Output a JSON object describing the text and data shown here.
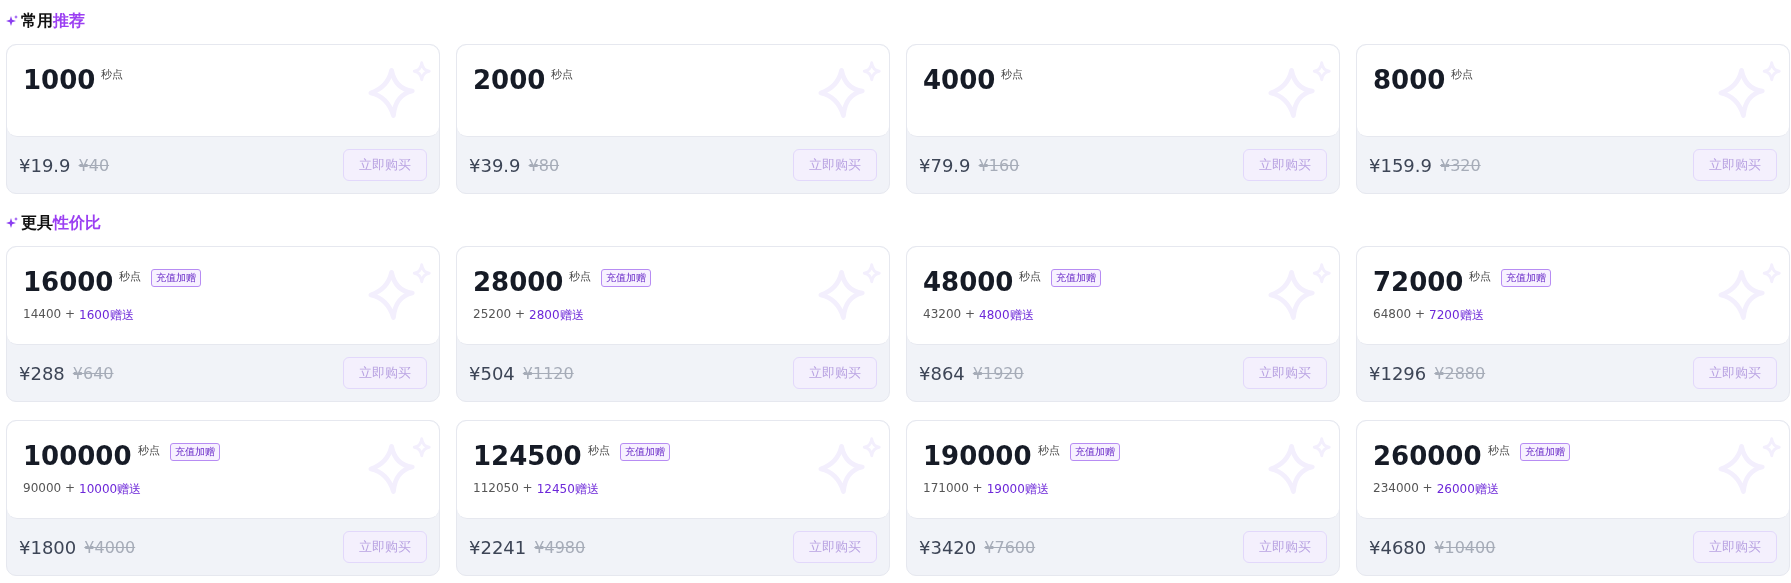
{
  "sections": [
    {
      "title": "常用",
      "title_accent": "推荐",
      "cards": [
        {
          "amount": "1000",
          "unit": "秒点",
          "price": "¥19.9",
          "original_price": "¥40",
          "button": {
            "label": "立即购买",
            "disabled": true
          }
        },
        {
          "amount": "2000",
          "unit": "秒点",
          "price": "¥39.9",
          "original_price": "¥80",
          "button": {
            "label": "立即购买",
            "disabled": true
          }
        },
        {
          "amount": "4000",
          "unit": "秒点",
          "price": "¥79.9",
          "original_price": "¥160",
          "button": {
            "label": "立即购买",
            "disabled": true
          }
        },
        {
          "amount": "8000",
          "unit": "秒点",
          "price": "¥159.9",
          "original_price": "¥320",
          "button": {
            "label": "立即购买",
            "disabled": true
          }
        }
      ]
    },
    {
      "title": "更具",
      "title_accent": "性价比",
      "cards": [
        {
          "amount": "16000",
          "unit": "秒点",
          "badge": "充值加赠",
          "base": "14400 +",
          "bonus": "1600赠送",
          "price": "¥288",
          "original_price": "¥640",
          "button": {
            "label": "立即购买",
            "disabled": true
          }
        },
        {
          "amount": "28000",
          "unit": "秒点",
          "badge": "充值加赠",
          "base": "25200 +",
          "bonus": "2800赠送",
          "price": "¥504",
          "original_price": "¥1120",
          "button": {
            "label": "立即购买",
            "disabled": true
          }
        },
        {
          "amount": "48000",
          "unit": "秒点",
          "badge": "充值加赠",
          "base": "43200 +",
          "bonus": "4800赠送",
          "price": "¥864",
          "original_price": "¥1920",
          "button": {
            "label": "立即购买",
            "disabled": true
          }
        },
        {
          "amount": "72000",
          "unit": "秒点",
          "badge": "充值加赠",
          "base": "64800 +",
          "bonus": "7200赠送",
          "price": "¥1296",
          "original_price": "¥2880",
          "button": {
            "label": "立即购买",
            "disabled": true
          }
        },
        {
          "amount": "100000",
          "unit": "秒点",
          "badge": "充值加赠",
          "base": "90000 +",
          "bonus": "10000赠送",
          "price": "¥1800",
          "original_price": "¥4000",
          "button": {
            "label": "立即购买",
            "disabled": true
          }
        },
        {
          "amount": "124500",
          "unit": "秒点",
          "badge": "充值加赠",
          "base": "112050 +",
          "bonus": "12450赠送",
          "price": "¥2241",
          "original_price": "¥4980",
          "button": {
            "label": "立即购买",
            "disabled": true
          }
        },
        {
          "amount": "190000",
          "unit": "秒点",
          "badge": "充值加赠",
          "base": "171000 +",
          "bonus": "19000赠送",
          "price": "¥3420",
          "original_price": "¥7600",
          "button": {
            "label": "立即购买",
            "disabled": true
          }
        },
        {
          "amount": "260000",
          "unit": "秒点",
          "badge": "充值加赠",
          "base": "234000 +",
          "bonus": "26000赠送",
          "price": "¥4680",
          "original_price": "¥10400",
          "button": {
            "label": "立即购买",
            "disabled": true
          }
        }
      ]
    }
  ]
}
